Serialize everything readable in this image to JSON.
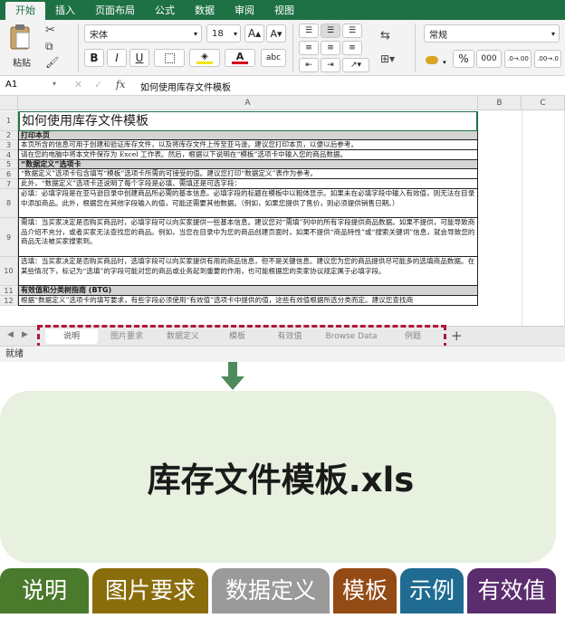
{
  "ribbon_tabs": [
    "开始",
    "插入",
    "页面布局",
    "公式",
    "数据",
    "审阅",
    "视图"
  ],
  "ribbon": {
    "paste": "粘贴",
    "font_name": "宋体",
    "font_size": "18",
    "bold": "B",
    "italic": "I",
    "underline": "U",
    "number_format": "常规",
    "percent": "%",
    "thousands": "000",
    "inc_decimal": ".0→.00",
    "dec_decimal": ".00→.0",
    "grow_font": "A▴",
    "shrink_font": "A▾",
    "abc": "abc",
    "colors": {
      "fill": "#f5e400",
      "font": "#d0021b",
      "brand": "#1e7145"
    }
  },
  "formula_bar": {
    "cell_ref": "A1",
    "fx": "fx",
    "content": "如何使用库存文件模板"
  },
  "columns": [
    "A",
    "B",
    "C"
  ],
  "rows": [
    {
      "num": "1",
      "text": "如何使用库存文件模板",
      "style": "title"
    },
    {
      "num": "2",
      "text": "打印本页",
      "style": "sec"
    },
    {
      "num": "3",
      "text": "本页所含的信息可用于创建和验证库存文件，以及将库存文件上传至亚马逊。建议您打印本页，以便以后参考。",
      "style": "normal"
    },
    {
      "num": "4",
      "text": "请在您的电脑中将本文件保存为 Excel 工作表。然后，根据以下说明在“模板”选项卡中输入您的商品数据。",
      "style": "normal"
    },
    {
      "num": "5",
      "text": "“数据定义”选项卡",
      "style": "sec"
    },
    {
      "num": "6",
      "text": "“数据定义”选项卡包含填写“模板”选项卡所需的可接受的值。建议您打印“数据定义”表作为参考。",
      "style": "normal"
    },
    {
      "num": "7",
      "text": "此外，“数据定义”选项卡还说明了每个字段是必填、需填还是可选字段：",
      "style": "normal"
    },
    {
      "num": "8",
      "text": "必填：必填字段是在亚马逊目录中创建商品所必需的基本信息。必填字段的标题在模板中以粗体显示。如果未在必填字段中输入有效值，则无法在目录中添加商品。此外，根据您在其他字段输入的值，可能还需要其他数据。（例如，如果您提供了售价，则必须提供销售日期。）",
      "style": "normal"
    },
    {
      "num": "9",
      "text": "需填：当买家决定是否购买商品时，必填字段可以向买家提供一些基本信息。建议您对“需填”列中的所有字段提供商品数据。如果不提供，可能导致商品介绍不充分，或者买家无法查找您的商品。例如，当您在目录中为您的商品创建页面时，如果不提供“商品特性”或“搜索关键词”信息，就会导致您的商品无法被买家搜索到。",
      "style": "normal"
    },
    {
      "num": "10",
      "text": "选填：当买家决定是否购买商品时，选填字段可以向买家提供有用的商品信息，但不是关键信息。建议您为您的商品提供尽可能多的选填商品数据。在某些情况下，标记为“选填”的字段可能对您的商品或业务起到重要的作用，也可能根据您的卖家协议规定属于必填字段。",
      "style": "normal"
    },
    {
      "num": "11",
      "text": "有效值和分类树指南 (BTG)",
      "style": "sec"
    },
    {
      "num": "12",
      "text": "根据“数据定义”选项卡的填写要求，有些字段必须使用“有效值”选项卡中提供的值，这些有效值根据所选分类而定。建议您查找商",
      "style": "normal"
    }
  ],
  "sheet_tabs": [
    "说明",
    "图片要求",
    "数据定义",
    "模板",
    "有效值",
    "Browse Data",
    "例题"
  ],
  "add_sheet": "+",
  "status": "就绪",
  "file_title": "库存文件模板.xls",
  "labels": [
    {
      "text": "说明",
      "color": "#4a7a2c"
    },
    {
      "text": "图片要求",
      "color": "#8a6d0b"
    },
    {
      "text": "数据定义",
      "color": "#9a9a9a"
    },
    {
      "text": "模板",
      "color": "#944a14"
    },
    {
      "text": "示例",
      "color": "#1f6b92"
    },
    {
      "text": "有效值",
      "color": "#5b2d6e"
    }
  ],
  "highlight_color": "#b0163a",
  "arrow_color": "#4e8a5b"
}
